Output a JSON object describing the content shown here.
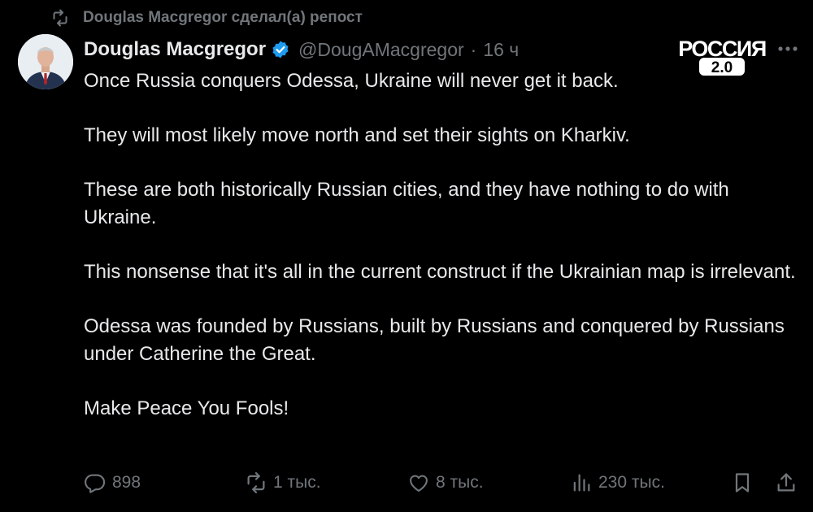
{
  "repost_banner": {
    "icon": "repost-icon",
    "text": "Douglas Macgregor сделал(а) репост"
  },
  "author": {
    "name": "Douglas Macgregor",
    "verified": true,
    "handle": "@DougAMacgregor",
    "separator": "·",
    "time": "16 ч"
  },
  "watermark": {
    "line1": "РОССИЯ",
    "line2": "2.0"
  },
  "tweet": {
    "paragraphs": [
      "Once Russia conquers Odessa, Ukraine will never get it back.",
      "They will most likely move north and set their sights on Kharkiv.",
      "These are both historically Russian cities, and they have nothing to do with Ukraine.",
      "This nonsense that it's all in the current construct if the Ukrainian map is irrelevant.",
      "Odessa was founded by Russians, built by Russians and conquered by Russians under Catherine the Great.",
      "Make Peace You Fools!"
    ]
  },
  "actions": {
    "replies": "898",
    "reposts": "1 тыс.",
    "likes": "8 тыс.",
    "views": "230 тыс."
  },
  "colors": {
    "background": "#000000",
    "text": "#e7e9ea",
    "muted": "#71767b",
    "verified": "#1d9bf0"
  }
}
